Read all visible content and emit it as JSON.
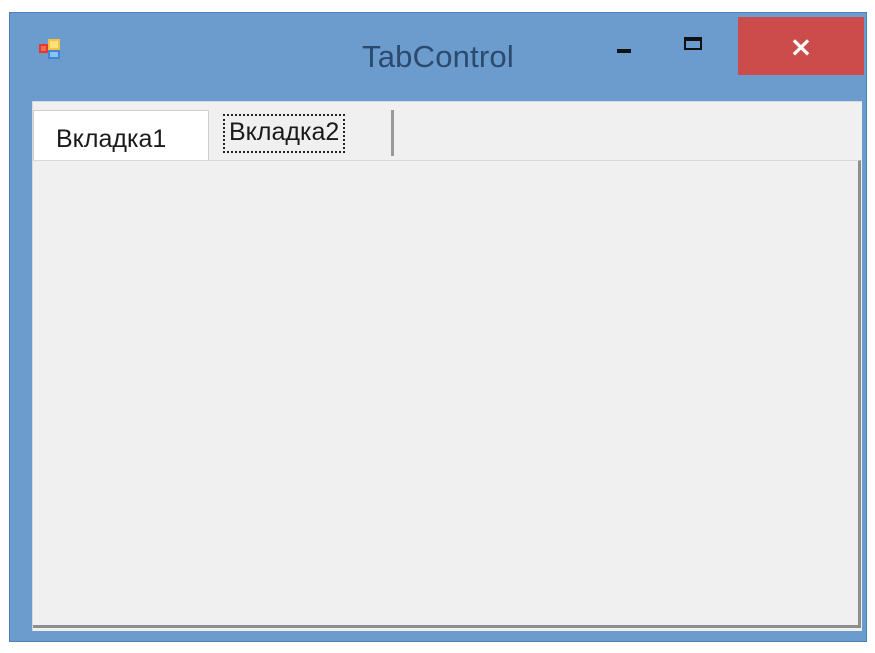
{
  "window": {
    "title": "TabControl",
    "app_icon": "winforms-app-icon",
    "controls": {
      "minimize_icon": "minimize-icon",
      "maximize_icon": "maximize-icon",
      "close_glyph": "×",
      "close_color": "#cc4b4b"
    },
    "frame_color": "#6b9ccd"
  },
  "tab_control": {
    "tabs": [
      {
        "label": "Вкладка1"
      },
      {
        "label": "Вкладка2"
      }
    ],
    "focused_tab": "Вкладка2"
  }
}
